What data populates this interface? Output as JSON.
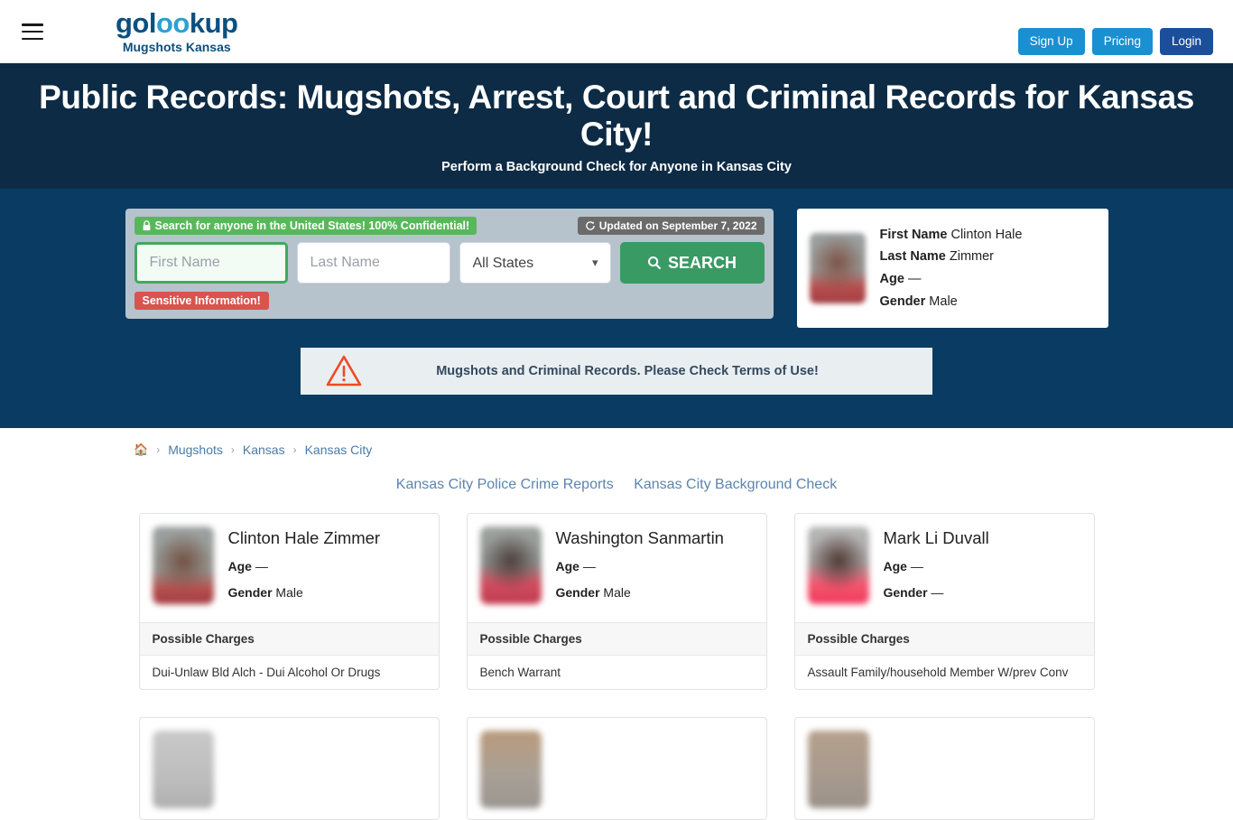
{
  "header": {
    "menu_icon": "hamburger-icon",
    "logo_text_1": "gol",
    "logo_text_2": "oo",
    "logo_text_3": "kup",
    "logo_subtitle": "Mugshots Kansas",
    "signup_label": "Sign Up",
    "pricing_label": "Pricing",
    "login_label": "Login",
    "colors": {
      "signup_bg": "#1a8fd1",
      "pricing_bg": "#1a8fd1",
      "login_bg": "#1b4f9c",
      "logo_dark": "#0b4f7f",
      "logo_light": "#2f9fd0"
    }
  },
  "hero": {
    "title": "Public Records: Mugshots, Arrest, Court and Criminal Records for Kansas City!",
    "subtitle": "Perform a Background Check for Anyone in Kansas City",
    "bg_color": "#0d2b45"
  },
  "search": {
    "confidential_badge": "Search for anyone in the United States! 100% Confidential!",
    "confidential_icon": "lock-icon",
    "updated_badge": "Updated on September 7, 2022",
    "updated_icon": "refresh-icon",
    "first_name_placeholder": "First Name",
    "first_name_value": "",
    "last_name_placeholder": "Last Name",
    "last_name_value": "",
    "state_selected": "All States",
    "state_options": [
      "All States"
    ],
    "search_button_label": "SEARCH",
    "search_icon": "search-icon",
    "sensitive_badge": "Sensitive Information!",
    "panel_bg": "#b6c3cc",
    "section_bg": "#0a3c63",
    "button_color": "#399a64"
  },
  "profile_card": {
    "photo": "blurred-mugshot",
    "first_name_label": "First Name",
    "first_name_value": "Clinton Hale",
    "last_name_label": "Last Name",
    "last_name_value": "Zimmer",
    "age_label": "Age",
    "age_value": "—",
    "gender_label": "Gender",
    "gender_value": "Male"
  },
  "notice": {
    "icon": "warning-triangle-icon",
    "text": "Mugshots and Criminal Records. Please Check Terms of Use!",
    "bg_color": "#e9eef1",
    "icon_color": "#ef4a23"
  },
  "breadcrumb": {
    "home_icon": "home-icon",
    "items": [
      "Mugshots",
      "Kansas",
      "Kansas City"
    ],
    "separator": "›"
  },
  "sub_links": [
    "Kansas City Police Crime Reports",
    "Kansas City Background Check"
  ],
  "cards": {
    "charges_header": "Possible Charges",
    "age_label": "Age",
    "gender_label": "Gender",
    "items": [
      {
        "name": "Clinton Hale Zimmer",
        "age": "—",
        "gender": "Male",
        "charge": "Dui-Unlaw Bld Alch - Dui Alcohol Or Drugs"
      },
      {
        "name": "Washington Sanmartin",
        "age": "—",
        "gender": "Male",
        "charge": "Bench Warrant"
      },
      {
        "name": "Mark Li Duvall",
        "age": "—",
        "gender": "—",
        "charge": "Assault Family/household Member W/prev Conv"
      }
    ]
  }
}
